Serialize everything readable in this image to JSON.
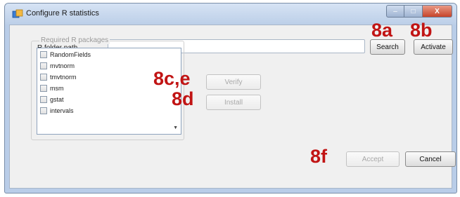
{
  "window": {
    "title": "Configure R statistics",
    "controls": {
      "minimize": "–",
      "maximize": "□",
      "close": "X"
    }
  },
  "form": {
    "r_folder_label": "R folder path",
    "r_folder_value": "",
    "search_button": "Search",
    "activate_button": "Activate",
    "group_label": "Required R packages",
    "verify_button": "Verify",
    "install_button": "Install",
    "accept_button": "Accept",
    "cancel_button": "Cancel"
  },
  "packages": [
    {
      "name": "RandomFields",
      "checked": false
    },
    {
      "name": "mvtnorm",
      "checked": false
    },
    {
      "name": "tmvtnorm",
      "checked": false
    },
    {
      "name": "msm",
      "checked": false
    },
    {
      "name": "gstat",
      "checked": false
    },
    {
      "name": "intervals",
      "checked": false
    }
  ],
  "annotations": {
    "a8a": "8a",
    "a8b": "8b",
    "a8ce": "8c,e",
    "a8d": "8d",
    "a8f": "8f",
    "color": "#c11414"
  }
}
